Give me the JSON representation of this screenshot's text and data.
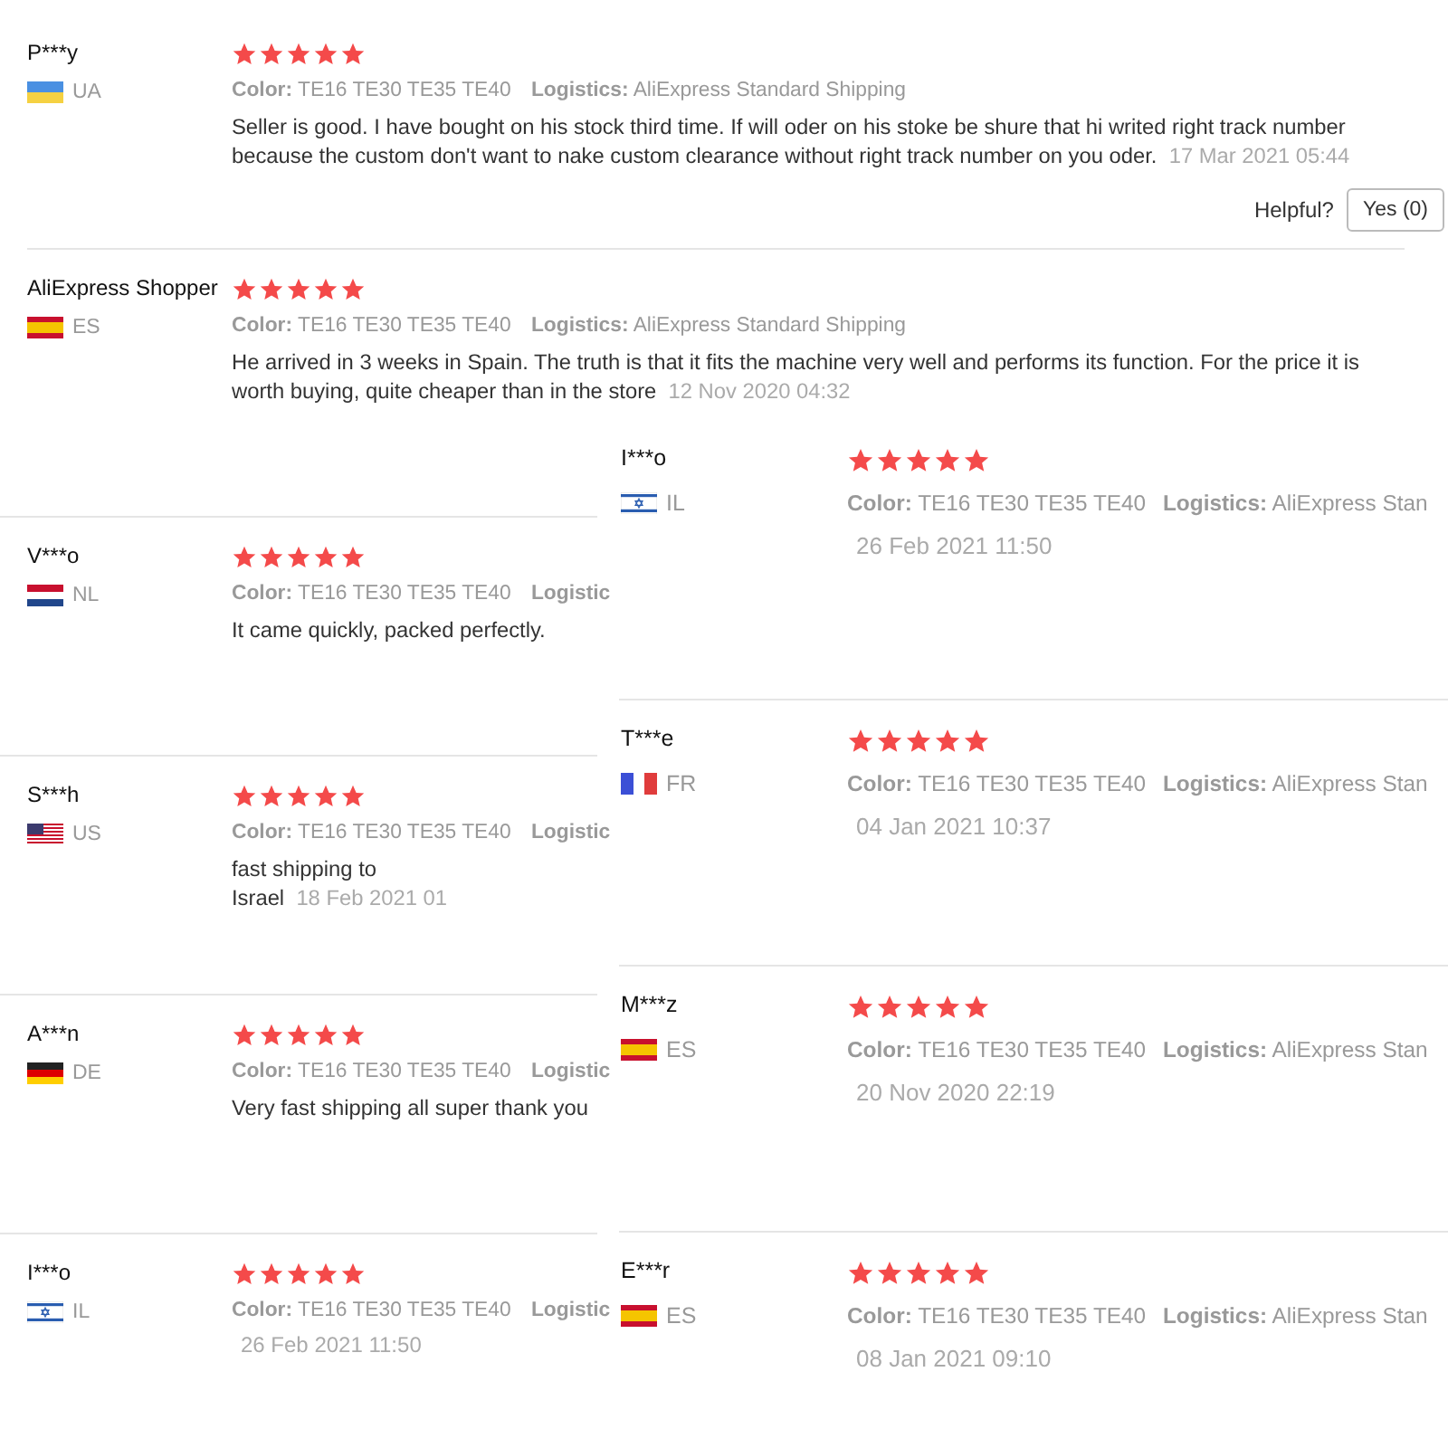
{
  "top_reviews": [
    {
      "name": "P***y",
      "kind": "ua",
      "country": "UA",
      "stars": 5,
      "color_label": "Color:",
      "variant": "TE16 TE30 TE35 TE40",
      "logistics_label": "Logistics:",
      "logistics": "AliExpress Standard Shipping",
      "text": "Seller is good. I have bought on his stock third time. If will oder on his stoke be shure that hi writed right track number because the custom don't want to nake custom clearance without right track number on you oder.",
      "date": "17 Mar 2021 05:44",
      "helpful_label": "Helpful?",
      "helpful_button": "Yes (0)"
    },
    {
      "name": "AliExpress Shopper",
      "kind": "es",
      "country": "ES",
      "stars": 5,
      "color_label": "Color:",
      "variant": "TE16 TE30 TE35 TE40",
      "logistics_label": "Logistics:",
      "logistics": "AliExpress Standard Shipping",
      "text": "He arrived in 3 weeks in Spain. The truth is that it fits the machine very well and performs its function. For the price it is worth buying, quite cheaper than in the store",
      "date": "12 Nov 2020 04:32"
    }
  ],
  "left_column": [
    {
      "name": "V***o",
      "kind": "nl",
      "country": "NL",
      "stars": 5,
      "color_label": "Color:",
      "variant": "TE16 TE30 TE35 TE40",
      "logistics_label": "Logistic",
      "text": "It came quickly, packed perfectly."
    },
    {
      "name": "S***h",
      "kind": "us",
      "country": "US",
      "stars": 5,
      "color_label": "Color:",
      "variant": "TE16 TE30 TE35 TE40",
      "logistics_label": "Logistic",
      "text": "fast shipping to Israel",
      "date": "18 Feb 2021 01"
    },
    {
      "name": "A***n",
      "kind": "de",
      "country": "DE",
      "stars": 5,
      "color_label": "Color:",
      "variant": "TE16 TE30 TE35 TE40",
      "logistics_label": "Logistic",
      "text": "Very fast shipping all super thank you"
    },
    {
      "name": "I***o",
      "kind": "il",
      "country": "IL",
      "stars": 5,
      "color_label": "Color:",
      "variant": "TE16 TE30 TE35 TE40",
      "logistics_label": "Logistic",
      "date": "26 Feb 2021 11:50"
    }
  ],
  "right_column": [
    {
      "name": "I***o",
      "kind": "il",
      "country": "IL",
      "stars": 5,
      "color_label": "Color:",
      "variant": "TE16 TE30 TE35 TE40",
      "logistics_label": "Logistics:",
      "logistics": "AliExpress Stan",
      "date": "26 Feb 2021 11:50"
    },
    {
      "name": "T***e",
      "kind": "fr",
      "country": "FR",
      "stars": 5,
      "color_label": "Color:",
      "variant": "TE16 TE30 TE35 TE40",
      "logistics_label": "Logistics:",
      "logistics": "AliExpress Stan",
      "date": "04 Jan 2021 10:37"
    },
    {
      "name": "M***z",
      "kind": "es",
      "country": "ES",
      "stars": 5,
      "color_label": "Color:",
      "variant": "TE16 TE30 TE35 TE40",
      "logistics_label": "Logistics:",
      "logistics": "AliExpress Stan",
      "date": "20 Nov 2020 22:19"
    },
    {
      "name": "E***r",
      "kind": "es",
      "country": "ES",
      "stars": 5,
      "color_label": "Color:",
      "variant": "TE16 TE30 TE35 TE40",
      "logistics_label": "Logistics:",
      "logistics": "AliExpress Stan",
      "date": "08 Jan 2021 09:10"
    }
  ]
}
